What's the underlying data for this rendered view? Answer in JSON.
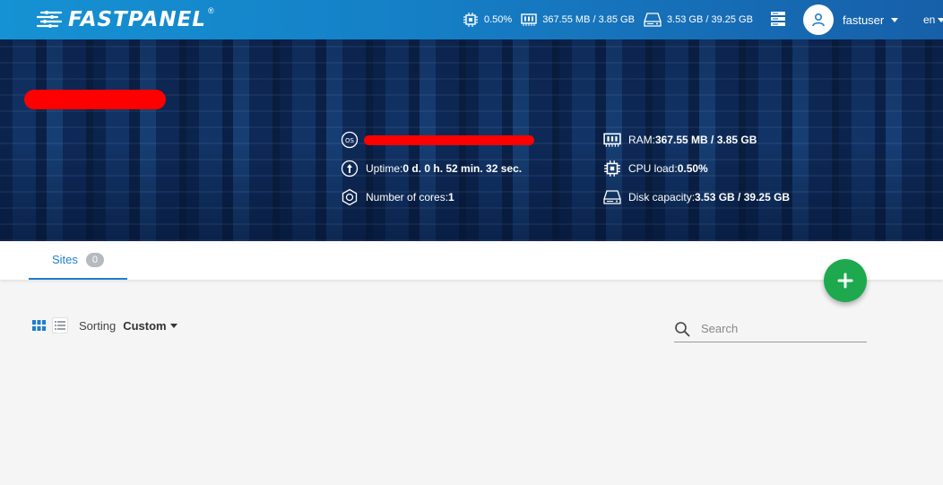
{
  "header": {
    "logo_text": "FASTPANEL",
    "logo_reg": "®",
    "cpu_stat": "0.50%",
    "ram_stat": "367.55 MB / 3.85 GB",
    "disk_stat": "3.53 GB / 39.25 GB",
    "username": "fastuser",
    "language": "en",
    "icons": [
      "cpu-icon",
      "ram-icon",
      "disk-icon",
      "server-list-icon",
      "user-icon"
    ]
  },
  "server_info": {
    "os_badge": "OS",
    "uptime_label": "Uptime: ",
    "uptime_value": "0 d. 0 h. 52 min. 32 sec.",
    "cores_label": "Number of cores: ",
    "cores_value": "1",
    "ram_label": "RAM: ",
    "ram_value": "367.55 MB / 3.85 GB",
    "cpu_label": "CPU load: ",
    "cpu_value": "0.50%",
    "disk_label": "Disk capacity: ",
    "disk_value": "3.53 GB / 39.25 GB"
  },
  "tabs": [
    {
      "label": "Sites",
      "count": "0"
    }
  ],
  "toolbar": {
    "sorting_label": "Sorting",
    "sorting_value": "Custom",
    "search_placeholder": "Search",
    "search_value": ""
  },
  "colors": {
    "accent": "#1c7fce",
    "fab": "#1ea94f",
    "redaction": "#ff0000"
  }
}
